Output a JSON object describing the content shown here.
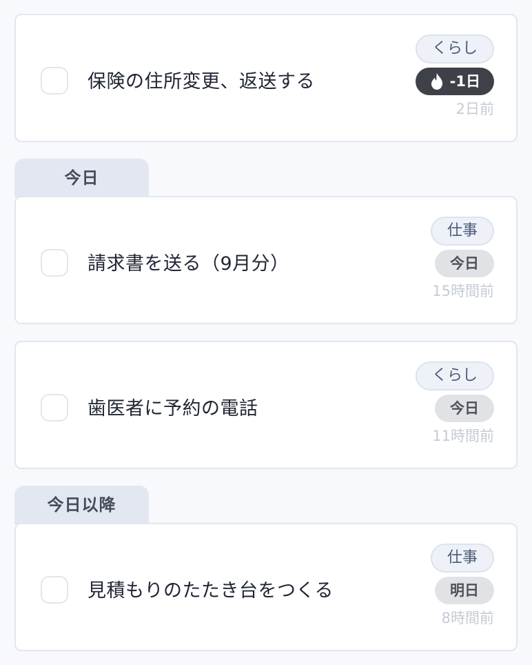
{
  "tasks": [
    {
      "title": "保険の住所変更、返送する",
      "category": "くらし",
      "due": "-1日",
      "due_icon": "flame-icon",
      "created": "2日前"
    },
    {
      "title": "請求書を送る（9月分）",
      "category": "仕事",
      "due": "今日",
      "created": "15時間前"
    },
    {
      "title": "歯医者に予約の電話",
      "category": "くらし",
      "due": "今日",
      "created": "11時間前"
    },
    {
      "title": "見積もりのたたき台をつくる",
      "category": "仕事",
      "due": "明日",
      "created": "8時間前"
    }
  ],
  "sections": [
    {
      "label": "今日"
    },
    {
      "label": "今日以降"
    }
  ],
  "colors": {
    "overdue_badge": "#3e4248",
    "due_badge": "#e1e2e5",
    "category_badge": "#eef2f8",
    "section_tab": "#e2e7f1"
  }
}
